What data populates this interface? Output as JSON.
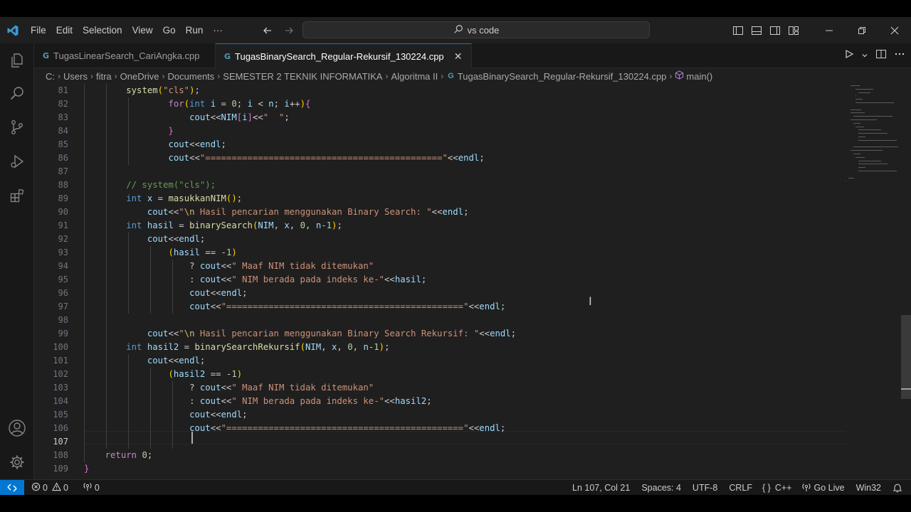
{
  "menu": [
    "File",
    "Edit",
    "Selection",
    "View",
    "Go",
    "Run",
    "···"
  ],
  "search": {
    "label": "vs code"
  },
  "tabs": [
    {
      "label": "TugasLinearSearch_CariAngka.cpp",
      "icon": "cpp-icon",
      "active": false
    },
    {
      "label": "TugasBinarySearch_Regular-Rekursif_130224.cpp",
      "icon": "cpp-icon",
      "active": true,
      "close": "✕"
    }
  ],
  "breadcrumb": {
    "parts": [
      "C:",
      "Users",
      "fitra",
      "OneDrive",
      "Documents",
      "SEMESTER 2 TEKNIK INFORMATIKA",
      "Algoritma II"
    ],
    "file": "TugasBinarySearch_Regular-Rekursif_130224.cpp",
    "symbol": "main()"
  },
  "editor": {
    "line_numbers": [
      "81",
      "82",
      "83",
      "84",
      "85",
      "86",
      "87",
      "88",
      "89",
      "90",
      "91",
      "92",
      "93",
      "94",
      "95",
      "96",
      "97",
      "98",
      "99",
      "100",
      "101",
      "102",
      "103",
      "104",
      "105",
      "106",
      "107",
      "108",
      "109"
    ],
    "current_line": "107",
    "lines": [
      "        system(\"cls\");",
      "                for(int i = 0; i < n; i++){",
      "                    cout<<NIM[i]<<\"  \";",
      "                }",
      "                cout<<endl;",
      "                cout<<\"=============================================\"<<endl;",
      "",
      "        // system(\"cls\");",
      "        int x = masukkanNIM();",
      "            cout<<\"\\n Hasil pencarian menggunakan Binary Search: \"<<endl;",
      "        int hasil = binarySearch(NIM, x, 0, n-1);",
      "            cout<<endl;",
      "                (hasil == -1)",
      "                    ? cout<<\" Maaf NIM tidak ditemukan\"",
      "                    : cout<<\" NIM berada pada indeks ke-\"<<hasil;",
      "                    cout<<endl;",
      "                    cout<<\"=============================================\"<<endl;",
      "",
      "            cout<<\"\\n Hasil pencarian menggunakan Binary Search Rekursif: \"<<endl;",
      "        int hasil2 = binarySearchRekursif(NIM, x, 0, n-1);",
      "            cout<<endl;",
      "                (hasil2 == -1)",
      "                    ? cout<<\" Maaf NIM tidak ditemukan\"",
      "                    : cout<<\" NIM berada pada indeks ke-\"<<hasil2;",
      "                    cout<<endl;",
      "                    cout<<\"=============================================\"<<endl;",
      "",
      "    return 0;",
      "}"
    ]
  },
  "statusbar": {
    "errors": "0",
    "warnings": "0",
    "ports": "0",
    "position": "Ln 107, Col 21",
    "spaces": "Spaces: 4",
    "encoding": "UTF-8",
    "eol": "CRLF",
    "language": "C++",
    "go_live": "Go Live",
    "platform": "Win32"
  },
  "colors": {
    "accent": "#0078d4",
    "editor_bg": "#1f1f1f",
    "keyword": "#569cd6",
    "string": "#ce9178",
    "function": "#dcdcaa",
    "variable": "#9cdcfe",
    "number": "#b5cea8",
    "comment": "#6a9955"
  }
}
